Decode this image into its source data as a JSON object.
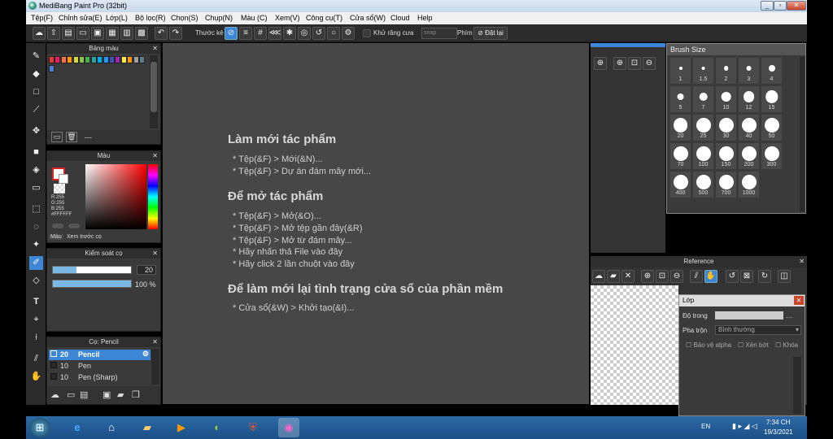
{
  "app": {
    "title": "MediBang Paint Pro (32bit)"
  },
  "menu": [
    "Tệp(F)",
    "Chỉnh sửa(E)",
    "Lớp(L)",
    "Bộ lọc(R)",
    "Chọn(S)",
    "Chụp(N)",
    "Màu (C)",
    "Xem(V)",
    "Công cụ(T)",
    "Cửa sổ(W)",
    "Cloud",
    "Help"
  ],
  "toolbar": {
    "guide_label": "Thước kẻ",
    "antialias_label": "Khử răng cưa",
    "snap_value": "snap",
    "key_label": "Phím",
    "reset_label": "Đặt lại"
  },
  "palette": {
    "title": "Bảng màu",
    "entry": "---",
    "swatches": [
      "#e53935",
      "#e91e63",
      "#ff7043",
      "#ff9800",
      "#cddc39",
      "#8bc34a",
      "#4caf50",
      "#26a69a",
      "#03a9f4",
      "#2196f3",
      "#3f51b5",
      "#9c27b0",
      "#ffeb3b",
      "#ff9800",
      "#9e9e9e",
      "#607d8b",
      "#4f7fd6"
    ]
  },
  "color": {
    "title": "Màu",
    "r": "R:255",
    "g": "G:255",
    "b": "B:255",
    "hex": "#FFFFFF",
    "tab1": "Màu",
    "tab2": "Xem trước cọ"
  },
  "control": {
    "title": "Kiểm soát cọ",
    "size": "20",
    "opacity": "100 %",
    "size_frac": 0.3,
    "opacity_frac": 1.0
  },
  "brushlist": {
    "title": "Cọ: Pencil",
    "rows": [
      {
        "size": "20",
        "name": "Pencil"
      },
      {
        "size": "10",
        "name": "Pen"
      },
      {
        "size": "10",
        "name": "Pen (Sharp)"
      }
    ]
  },
  "canvas": {
    "s1": "Làm mới tác phẩm",
    "s1a": "* Tệp(&F) > Mới(&N)...",
    "s1b": "* Tệp(&F) > Dự án đám mây mới...",
    "s2": "Để mở tác phẩm",
    "s2a": "* Tệp(&F) > Mở(&O)...",
    "s2b": "* Tệp(&F) > Mở tệp gần đây(&R)",
    "s2c": "* Tệp(&F) > Mở từ đám mây...",
    "s2d": "* Hãy nhấn thả File vào đây",
    "s2e": "* Hãy click 2 lần chuột vào đây",
    "s3": "Để làm mới lại tình trạng cửa sổ của phần mềm",
    "s3a": "* Cửa sổ(&W) > Khởi tạo(&I)..."
  },
  "brushsize": {
    "title": "Brush Size",
    "sizes": [
      "1",
      "1.5",
      "2",
      "3",
      "4",
      "5",
      "7",
      "10",
      "12",
      "15",
      "20",
      "25",
      "30",
      "40",
      "50",
      "70",
      "100",
      "150",
      "200",
      "300",
      "400",
      "500",
      "700",
      "1000"
    ]
  },
  "reference": {
    "title": "Reference"
  },
  "layer": {
    "title": "Lớp",
    "opacity_label": "Độ trong",
    "blend_label": "Pha trộn",
    "blend_value": "Bình thường",
    "alpha_label": "Bảo vệ alpha",
    "clip_label": "Xén bớt",
    "lock_label": "Khóa"
  },
  "taskbar": {
    "lang": "EN",
    "time": "7:34 CH",
    "date": "19/3/2021"
  }
}
